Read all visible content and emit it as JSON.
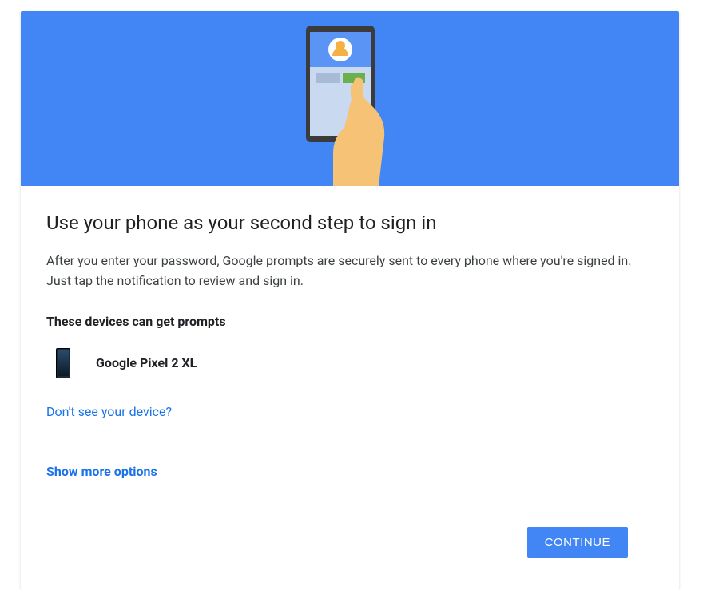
{
  "title": "Use your phone as your second step to sign in",
  "description": "After you enter your password, Google prompts are securely sent to every phone where you're signed in. Just tap the notification to review and sign in.",
  "devices_heading": "These devices can get prompts",
  "devices": [
    {
      "name": "Google Pixel 2 XL"
    }
  ],
  "dont_see_link": "Don't see your device?",
  "more_options_link": "Show more options",
  "continue_label": "CONTINUE"
}
